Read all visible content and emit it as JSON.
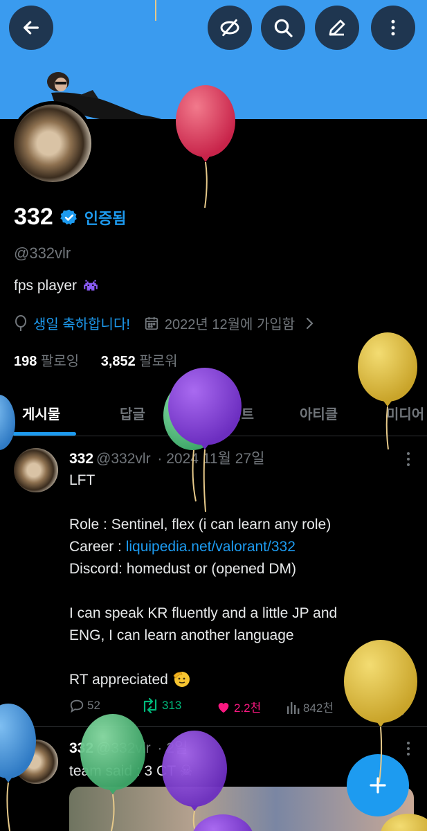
{
  "profile": {
    "name": "332",
    "verified_label": "인증됨",
    "handle": "@332vlr",
    "bio": "fps player",
    "birthday_text": "생일 축하합니다!",
    "joined_text": "2022년 12월에 가입함",
    "following_count": "198",
    "following_label": "팔로잉",
    "followers_count": "3,852",
    "followers_label": "팔로워"
  },
  "tabs": [
    {
      "label": "게시물",
      "active": true
    },
    {
      "label": "답글",
      "active": false
    },
    {
      "label": "하이라이트",
      "active": false
    },
    {
      "label": "아티클",
      "active": false
    },
    {
      "label": "미디어",
      "active": false
    }
  ],
  "posts": [
    {
      "name": "332",
      "handle": "@332vlr",
      "date": "· 2024 11월 27일",
      "lines": [
        "LFT",
        "",
        "Role : Sentinel, flex (i can learn any role)",
        "Career : ",
        "Discord: homedust or (opened DM)",
        "",
        "I can speak KR fluently and a little JP and",
        "ENG, I can learn another language",
        "",
        "RT appreciated"
      ],
      "career_link": "liquipedia.net/valorant/332",
      "replies": "52",
      "reposts": "313",
      "likes": "2.2천",
      "views": "842천"
    },
    {
      "name": "332",
      "handle": "@332vlr",
      "date": "· 2일",
      "text": "team said : 3 CT"
    }
  ],
  "icons": {
    "back": "arrow-left-icon",
    "mute": "eye-off-icon",
    "search": "search-icon",
    "edit": "pencil-icon",
    "more": "more-vertical-icon",
    "verified": "verified-badge-icon",
    "location": "balloon-icon",
    "calendar": "calendar-icon",
    "compose": "plus-icon"
  },
  "colors": {
    "accent": "#1d9bf0",
    "banner": "#3a9bef",
    "repost": "#00ba7c",
    "like": "#f91880",
    "muted": "#71767b"
  }
}
